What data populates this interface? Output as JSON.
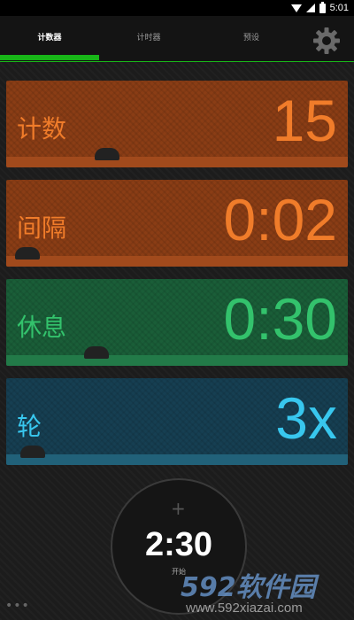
{
  "status_bar": {
    "time": "5:01",
    "icons": [
      "wifi-icon",
      "signal-icon",
      "battery-icon"
    ]
  },
  "tabs": [
    {
      "label": "计数器",
      "active": true
    },
    {
      "label": "计时器",
      "active": false
    },
    {
      "label": "预设",
      "active": false
    }
  ],
  "settings_icon": "gear-icon",
  "cards": {
    "count": {
      "label": "计数",
      "value": "15",
      "color": "#f07c2a"
    },
    "interval": {
      "label": "间隔",
      "value": "0:02",
      "color": "#f07c2a"
    },
    "rest": {
      "label": "休息",
      "value": "0:30",
      "color": "#33c26c"
    },
    "rounds": {
      "label": "轮",
      "value": "3x",
      "color": "#38c7ee"
    }
  },
  "start_button": {
    "plus": "+",
    "total_time": "2:30",
    "label": "开始"
  },
  "more_icon": "•••",
  "watermark": {
    "logo": "592软件园",
    "url": "www.592xiazai.com"
  },
  "colors": {
    "accent": "#18b618"
  }
}
